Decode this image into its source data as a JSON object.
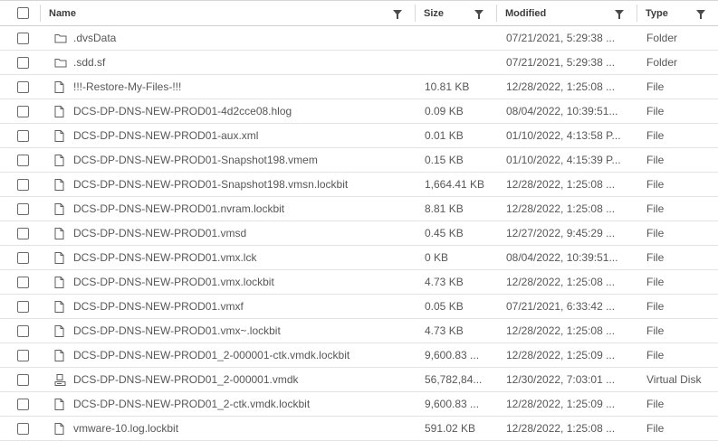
{
  "columns": [
    {
      "key": "name",
      "label": "Name"
    },
    {
      "key": "size",
      "label": "Size"
    },
    {
      "key": "modified",
      "label": "Modified"
    },
    {
      "key": "type",
      "label": "Type"
    }
  ],
  "rows": [
    {
      "icon": "folder-icon",
      "name": ".dvsData",
      "size": "",
      "modified": "07/21/2021, 5:29:38 ...",
      "type": "Folder"
    },
    {
      "icon": "folder-icon",
      "name": ".sdd.sf",
      "size": "",
      "modified": "07/21/2021, 5:29:38 ...",
      "type": "Folder"
    },
    {
      "icon": "file-icon",
      "name": "!!!-Restore-My-Files-!!!",
      "size": "10.81 KB",
      "modified": "12/28/2022, 1:25:08 ...",
      "type": "File"
    },
    {
      "icon": "file-icon",
      "name": "DCS-DP-DNS-NEW-PROD01-4d2cce08.hlog",
      "size": "0.09 KB",
      "modified": "08/04/2022, 10:39:51...",
      "type": "File"
    },
    {
      "icon": "file-icon",
      "name": "DCS-DP-DNS-NEW-PROD01-aux.xml",
      "size": "0.01 KB",
      "modified": "01/10/2022, 4:13:58 P...",
      "type": "File"
    },
    {
      "icon": "file-icon",
      "name": "DCS-DP-DNS-NEW-PROD01-Snapshot198.vmem",
      "size": "0.15 KB",
      "modified": "01/10/2022, 4:15:39 P...",
      "type": "File"
    },
    {
      "icon": "file-icon",
      "name": "DCS-DP-DNS-NEW-PROD01-Snapshot198.vmsn.lockbit",
      "size": "1,664.41 KB",
      "modified": "12/28/2022, 1:25:08 ...",
      "type": "File"
    },
    {
      "icon": "file-icon",
      "name": "DCS-DP-DNS-NEW-PROD01.nvram.lockbit",
      "size": "8.81 KB",
      "modified": "12/28/2022, 1:25:08 ...",
      "type": "File"
    },
    {
      "icon": "file-icon",
      "name": "DCS-DP-DNS-NEW-PROD01.vmsd",
      "size": "0.45 KB",
      "modified": "12/27/2022, 9:45:29 ...",
      "type": "File"
    },
    {
      "icon": "file-icon",
      "name": "DCS-DP-DNS-NEW-PROD01.vmx.lck",
      "size": "0 KB",
      "modified": "08/04/2022, 10:39:51...",
      "type": "File"
    },
    {
      "icon": "file-icon",
      "name": "DCS-DP-DNS-NEW-PROD01.vmx.lockbit",
      "size": "4.73 KB",
      "modified": "12/28/2022, 1:25:08 ...",
      "type": "File"
    },
    {
      "icon": "file-icon",
      "name": "DCS-DP-DNS-NEW-PROD01.vmxf",
      "size": "0.05 KB",
      "modified": "07/21/2021, 6:33:42 ...",
      "type": "File"
    },
    {
      "icon": "file-icon",
      "name": "DCS-DP-DNS-NEW-PROD01.vmx~.lockbit",
      "size": "4.73 KB",
      "modified": "12/28/2022, 1:25:08 ...",
      "type": "File"
    },
    {
      "icon": "file-icon",
      "name": "DCS-DP-DNS-NEW-PROD01_2-000001-ctk.vmdk.lockbit",
      "size": "9,600.83 ...",
      "modified": "12/28/2022, 1:25:09 ...",
      "type": "File"
    },
    {
      "icon": "virtual-disk-icon",
      "name": "DCS-DP-DNS-NEW-PROD01_2-000001.vmdk",
      "size": "56,782,84...",
      "modified": "12/30/2022, 7:03:01 ...",
      "type": "Virtual Disk"
    },
    {
      "icon": "file-icon",
      "name": "DCS-DP-DNS-NEW-PROD01_2-ctk.vmdk.lockbit",
      "size": "9,600.83 ...",
      "modified": "12/28/2022, 1:25:09 ...",
      "type": "File"
    },
    {
      "icon": "file-icon",
      "name": "vmware-10.log.lockbit",
      "size": "591.02 KB",
      "modified": "12/28/2022, 1:25:08 ...",
      "type": "File"
    }
  ],
  "colors": {
    "border": "#d6d6d6",
    "row_border": "#e3e3e3",
    "text": "#575757",
    "header_text": "#3c3c3c"
  }
}
